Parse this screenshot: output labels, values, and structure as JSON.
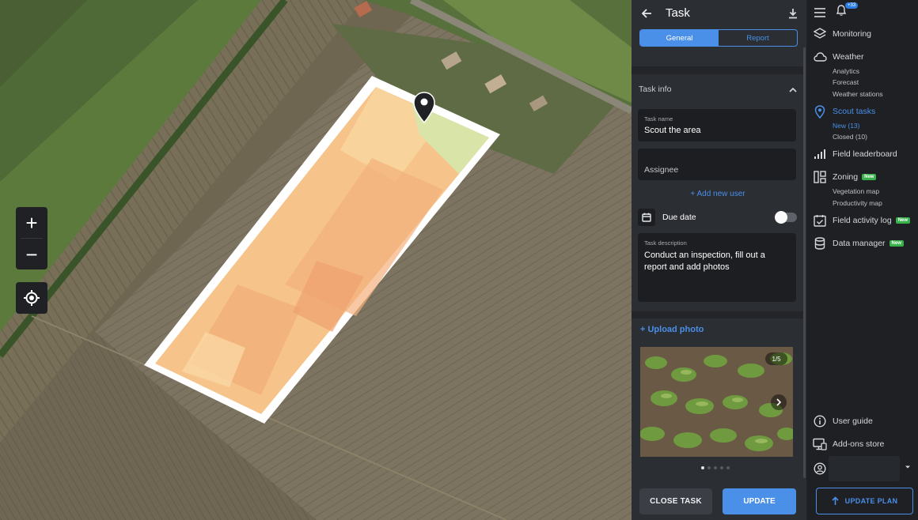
{
  "map": {
    "zoom_in": "+",
    "zoom_out": "−"
  },
  "task_panel": {
    "title": "Task",
    "tabs": [
      {
        "label": "General",
        "active": true
      },
      {
        "label": "Report",
        "active": false
      }
    ],
    "section_title": "Task info",
    "task_name": {
      "caption": "Task name",
      "value": "Scout the area"
    },
    "assignee": {
      "placeholder": "Assignee"
    },
    "add_user": "+ Add new user",
    "due_date": {
      "label": "Due date",
      "enabled": false
    },
    "description": {
      "caption": "Task description",
      "value": "Conduct an inspection, fill out a report and add photos"
    },
    "upload_label": "+ Upload photo",
    "photo_counter": "1/5",
    "photo_pagination": {
      "current": 1,
      "total": 5
    },
    "close_button": "CLOSE TASK",
    "update_button": "UPDATE"
  },
  "nav": {
    "notification_badge": "+33",
    "items": [
      {
        "label": "Monitoring",
        "icon": "layers-icon"
      },
      {
        "label": "Weather",
        "icon": "cloud-icon",
        "subs": [
          "Analytics",
          "Forecast",
          "Weather stations"
        ]
      },
      {
        "label": "Scout tasks",
        "icon": "pin-icon",
        "active": true,
        "subs": [
          "New (13)",
          "Closed (10)"
        ]
      },
      {
        "label": "Field leaderboard",
        "icon": "bar-chart-icon"
      },
      {
        "label": "Zoning",
        "icon": "zoning-icon",
        "badge": "New",
        "subs": [
          "Vegetation map",
          "Productivity map"
        ]
      },
      {
        "label": "Field activity log",
        "icon": "calendar-check-icon",
        "badge": "New"
      },
      {
        "label": "Data manager",
        "icon": "database-icon",
        "badge": "New"
      }
    ],
    "bottom": [
      {
        "label": "User guide",
        "icon": "info-icon"
      },
      {
        "label": "Add-ons store",
        "icon": "store-icon"
      }
    ],
    "update_plan": "UPDATE PLAN"
  },
  "colors": {
    "accent": "#4a8fe8",
    "panel_bg": "#2b2e33",
    "nav_bg": "#1e2024",
    "new_badge": "#38b24b"
  }
}
